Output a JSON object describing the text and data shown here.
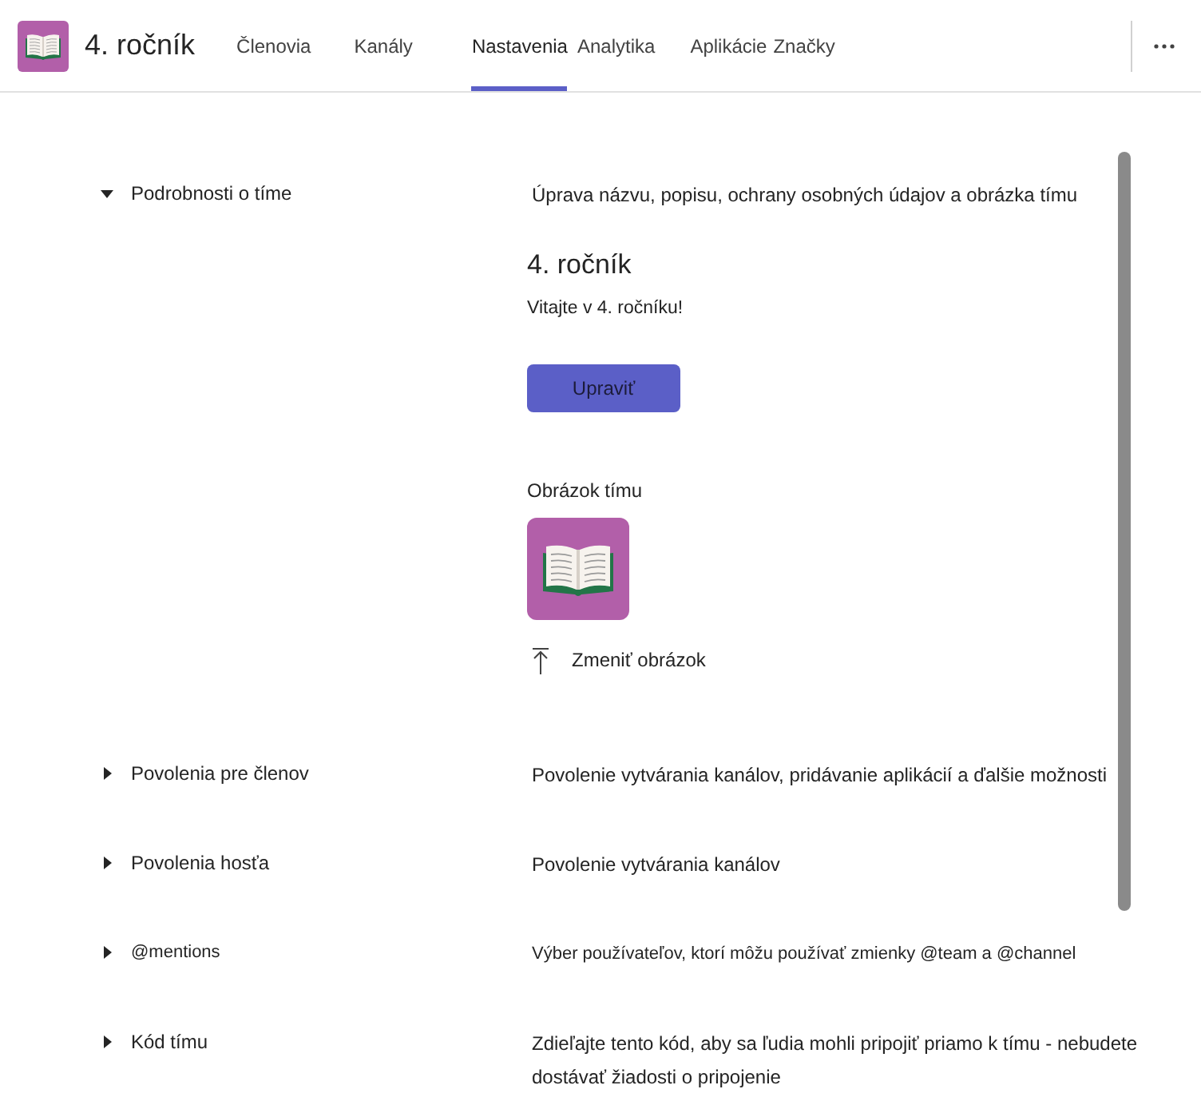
{
  "header": {
    "team_name": "4. ročník",
    "tabs": [
      {
        "label": "Členovia",
        "selected": false
      },
      {
        "label": "Kanály",
        "selected": false
      },
      {
        "label": "Nastavenia",
        "selected": true
      },
      {
        "label": "Analytika",
        "selected": false
      },
      {
        "label": "Aplikácie",
        "selected": false
      },
      {
        "label": "Značky",
        "selected": false
      }
    ]
  },
  "sections": [
    {
      "title": "Podrobnosti o tíme",
      "description": "Úprava názvu, popisu, ochrany osobných údajov a obrázka tímu",
      "expanded": true,
      "details": {
        "team_name": "4. ročník",
        "welcome_message": "Vitajte v 4. ročníku!",
        "edit_button": "Upraviť",
        "picture_label": "Obrázok tímu",
        "change_picture": "Zmeniť obrázok"
      }
    },
    {
      "title": "Povolenia pre členov",
      "description": "Povolenie vytvárania kanálov, pridávanie aplikácií a ďalšie možnosti",
      "expanded": false
    },
    {
      "title": "Povolenia hosťa",
      "description": "Povolenie vytvárania kanálov",
      "expanded": false
    },
    {
      "title": "@mentions",
      "description": "Výber používateľov, ktorí môžu používať zmienky @team a @channel",
      "expanded": false
    },
    {
      "title": "Kód tímu",
      "description": "Zdieľajte tento kód, aby sa ľudia mohli pripojiť priamo k tímu - nebudete dostávať žiadosti o pripojenie",
      "expanded": false
    }
  ]
}
